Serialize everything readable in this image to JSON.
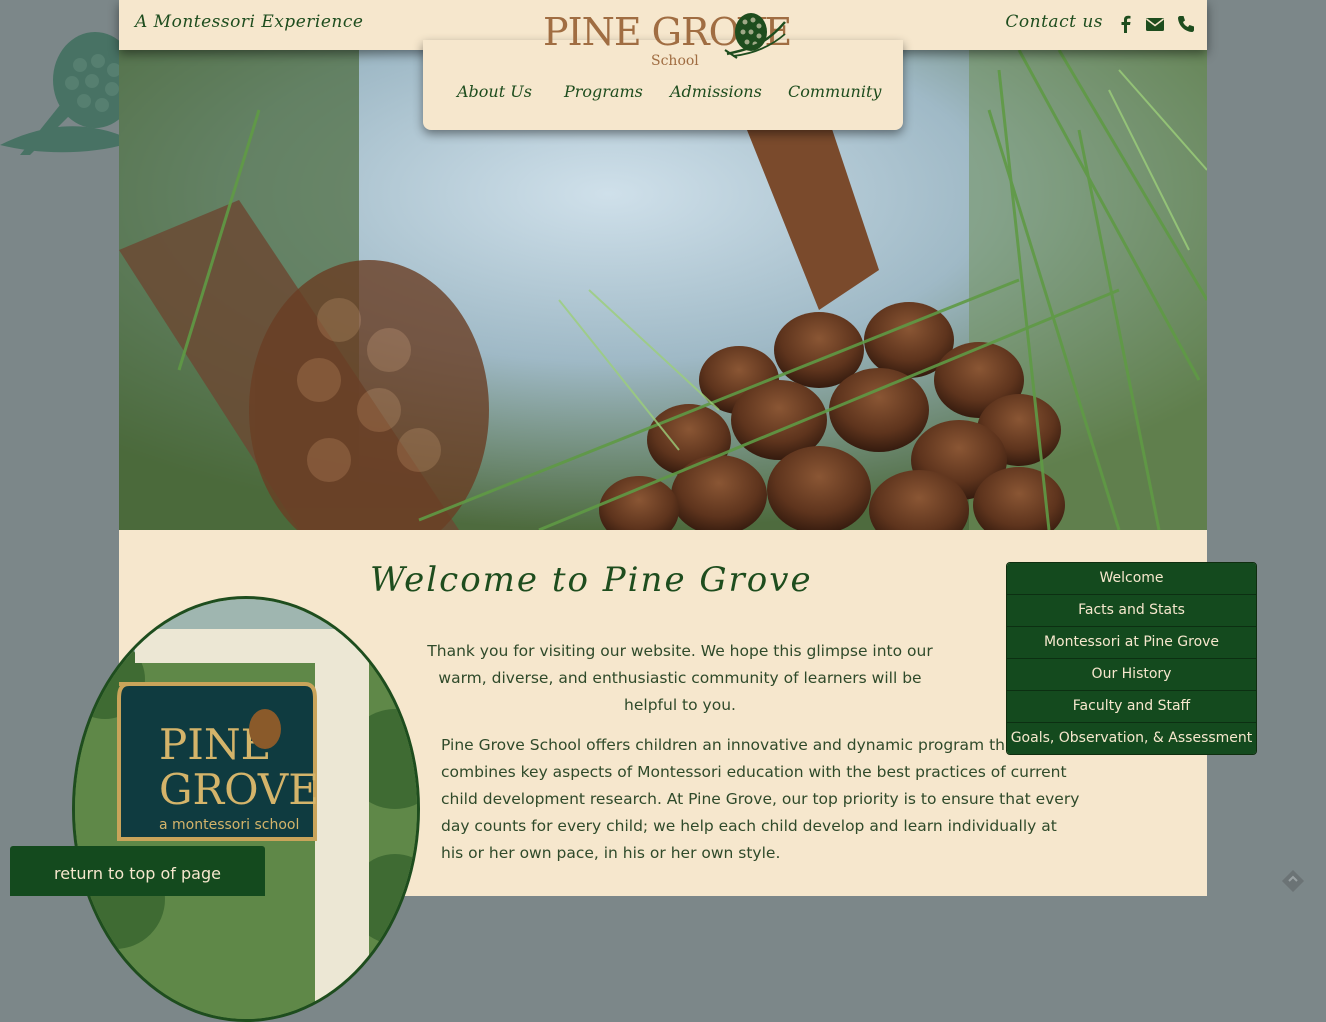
{
  "header": {
    "tagline": "A Montessori Experience",
    "contact_label": "Contact us",
    "icons": [
      "facebook-icon",
      "envelope-icon",
      "phone-icon"
    ]
  },
  "logo": {
    "name": "PINE GROVE",
    "sub": "School"
  },
  "nav": {
    "items": [
      "About Us",
      "Programs",
      "Admissions",
      "Community"
    ]
  },
  "main": {
    "title": "Welcome to Pine Grove",
    "intro": "Thank you for visiting our website. We hope this glimpse into our warm, diverse, and enthusiastic community of learners will be helpful to you.",
    "body": "Pine Grove School offers children an innovative and dynamic program that combines key aspects of Montessori education with the best practices of current child development research. At Pine Grove, our top priority is to ensure that every day counts for every child; we help each child develop and learn individually at his or her own pace, in his or her own style."
  },
  "sign": {
    "line1": "PINE",
    "line2": "GROVE",
    "line3": "a montessori school"
  },
  "subnav": {
    "items": [
      "Welcome",
      "Facts and Stats",
      "Montessori at Pine Grove",
      "Our History",
      "Faculty and Staff",
      "Goals, Observation, & Assessment"
    ]
  },
  "footer": {
    "return_label": "return to top of page"
  },
  "colors": {
    "background": "#7c8789",
    "panel": "#f6e7cd",
    "brand_green": "#144a1e",
    "logo_brown": "#a06d42"
  }
}
